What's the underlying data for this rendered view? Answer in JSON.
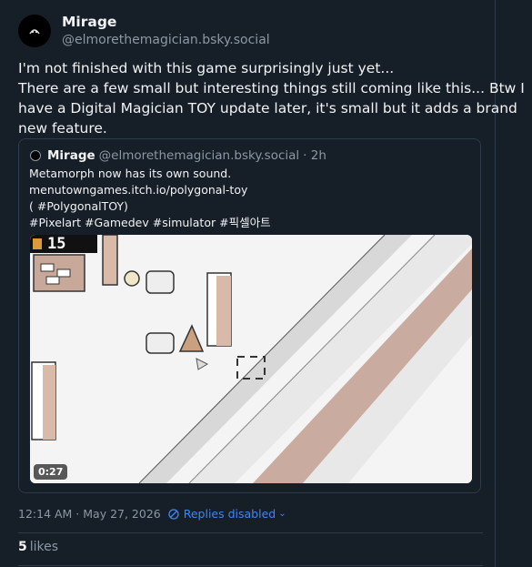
{
  "author": {
    "display_name": "Mirage",
    "handle": "@elmorethemagician.bsky.social"
  },
  "post": {
    "lines": [
      "I'm not finished with this game surprisingly just yet...",
      "There are a few small but interesting things still coming like this... Btw I",
      "have a Digital Magician TOY update later, it's small but it adds a brand",
      "new feature."
    ]
  },
  "quote": {
    "display_name": "Mirage",
    "handle": "@elmorethemagician.bsky.social",
    "age": "· 2h",
    "lines": [
      "Metamorph now has its own sound.",
      "menutowngames.itch.io/polygonal-toy",
      "( #PolygonalTOY)",
      "#Pixelart #Gamedev #simulator #픽셀아트"
    ],
    "video": {
      "duration": "0:27",
      "counter": "15"
    }
  },
  "meta": {
    "timestamp": "12:14 AM · May 27, 2026",
    "replies_label": "Replies disabled",
    "chevron": "⌄"
  },
  "likes": {
    "count": "5",
    "label": "likes"
  },
  "colors": {
    "background": "#161e27",
    "accent": "#3f87f0",
    "muted": "#8b98a5"
  }
}
